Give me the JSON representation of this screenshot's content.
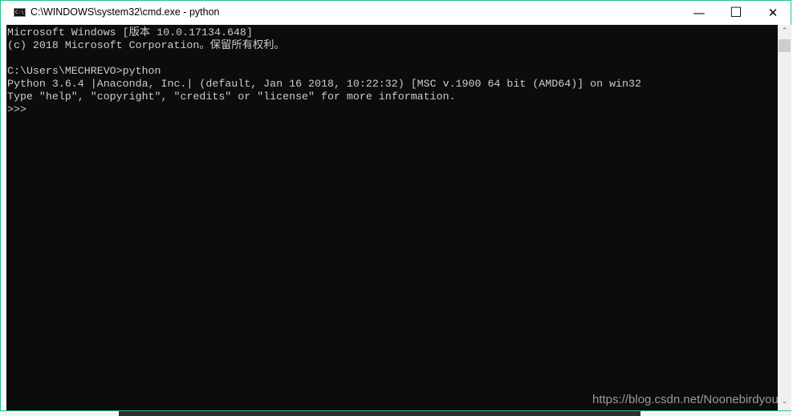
{
  "window": {
    "title": "C:\\WINDOWS\\system32\\cmd.exe - python",
    "icon": "cmd-icon",
    "icon_text": "C:\\",
    "minimize": "—",
    "maximize": "☐",
    "close": "✕",
    "border_color": "#26c281"
  },
  "console": {
    "background": "#0c0c0c",
    "foreground": "#cccccc",
    "lines": [
      "Microsoft Windows [版本 10.0.17134.648]",
      "(c) 2018 Microsoft Corporation。保留所有权利。",
      "",
      "C:\\Users\\MECHREVO>python",
      "Python 3.6.4 |Anaconda, Inc.| (default, Jan 16 2018, 10:22:32) [MSC v.1900 64 bit (AMD64)] on win32",
      "Type \"help\", \"copyright\", \"credits\" or \"license\" for more information.",
      ">>>"
    ]
  },
  "scrollbar": {
    "up": "⌃",
    "down": "⌄"
  },
  "watermark": "https://blog.csdn.net/Noonebirdyou"
}
